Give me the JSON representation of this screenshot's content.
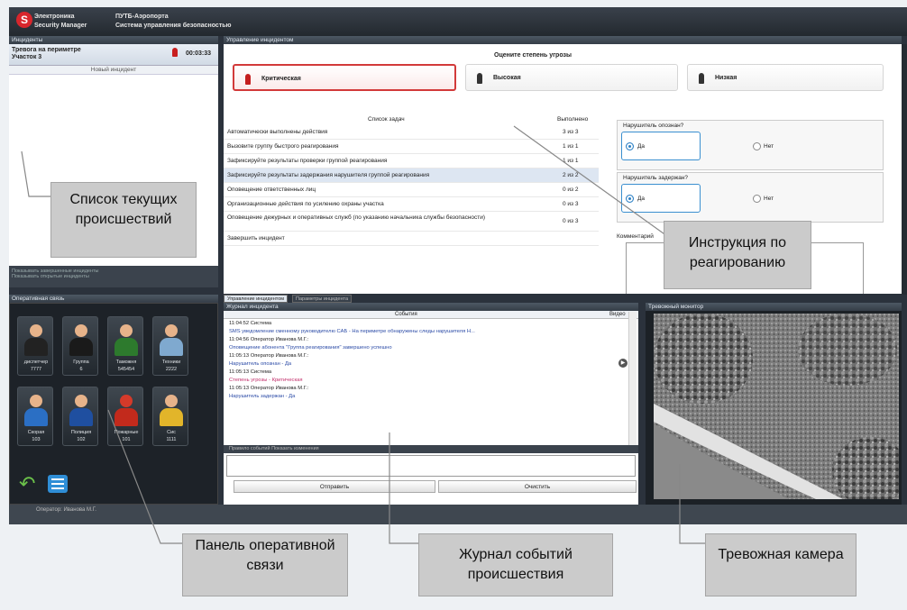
{
  "app": {
    "brand_line1": "Электроника",
    "brand_line2": "Security Manager",
    "title_line1": "ПУТБ-Аэропорта",
    "title_line2": "Система управления безопасностью"
  },
  "panels": {
    "incidents": "Инциденты",
    "management": "Управление инцидентом",
    "comm": "Оперативная связь",
    "log": "Журнал инцидента",
    "alarm_monitor": "Тревожный монитор"
  },
  "incident": {
    "title": "Тревога на периметре",
    "sub": "Участок 3",
    "time": "00:03:33",
    "new_label": "Новый инцидент",
    "footer1": "Показывать завершенные инциденты",
    "footer2": "Показывать открытые инциденты"
  },
  "threat": {
    "question": "Оцените степень угрозы",
    "levels": [
      "Критическая",
      "Высокая",
      "Низкая"
    ]
  },
  "tasks": {
    "header": "Список задач",
    "done_header": "Выполнено",
    "items": [
      {
        "name": "Автоматически выполнены действия",
        "count": "3 из 3"
      },
      {
        "name": "Вызовите группу быстрого реагирования",
        "count": "1 из 1"
      },
      {
        "name": "Зафиксируйте результаты проверки группой реагирования",
        "count": "1 из 1"
      },
      {
        "name": "Зафиксируйте результаты задержания нарушителя группой реагирования",
        "count": "2 из 2"
      },
      {
        "name": "Оповещение ответственных лиц",
        "count": "0 из 2"
      },
      {
        "name": "Организационные действия по усилению охраны участка",
        "count": "0 из 3"
      },
      {
        "name": "Оповещение дежурных и оперативных служб (по указанию начальника службы безопасности)",
        "count": "0 из 3"
      },
      {
        "name": "Завершить инцидент",
        "count": ""
      }
    ]
  },
  "questions": [
    {
      "label": "Нарушитель опознан?",
      "yes": "Да",
      "no": "Нет"
    },
    {
      "label": "Нарушитель задержан?",
      "yes": "Да",
      "no": "Нет"
    }
  ],
  "comment_label": "Комментарий",
  "tabs": [
    "Управление инцидентом",
    "Параметры инцидента"
  ],
  "contacts": [
    {
      "name": "диспетчер",
      "num": "7777",
      "icon": "suit-agent-icon"
    },
    {
      "name": "Группа",
      "num": "6",
      "icon": "guard-icon"
    },
    {
      "name": "Таможня",
      "num": "545454",
      "icon": "customs-officer-icon"
    },
    {
      "name": "Техники",
      "num": "2222",
      "icon": "technician-icon"
    },
    {
      "name": "Скорая",
      "num": "103",
      "icon": "medic-icon"
    },
    {
      "name": "Полиция",
      "num": "102",
      "icon": "police-icon"
    },
    {
      "name": "Пожарные",
      "num": "101",
      "icon": "firefighter-icon"
    },
    {
      "name": "Сис",
      "num": "1111",
      "icon": "sysadmin-icon"
    }
  ],
  "log": {
    "header": "События",
    "col_video": "Видео",
    "entries": [
      {
        "text": "11:04:52    Система",
        "cls": "sys"
      },
      {
        "text": "SMS уведомление сменному руководителю САБ - На периметре обнаружены следы нарушителя Н...",
        "cls": "blue"
      },
      {
        "text": "11:04:56    Оператор Иванова М.Г.:",
        "cls": "sys"
      },
      {
        "text": "Оповещение абонента \"Группа реагирования\" завершено успешно",
        "cls": "blue"
      },
      {
        "text": "11:05:13    Оператор Иванова М.Г.:",
        "cls": "sys"
      },
      {
        "text": "Нарушитель опознан - Да",
        "cls": "blue"
      },
      {
        "text": "11:05:13    Система",
        "cls": "sys"
      },
      {
        "text": "Степень угрозы - Критическая",
        "cls": "pinkc"
      },
      {
        "text": "11:05:13    Оператор Иванова М.Г.:",
        "cls": "sys"
      },
      {
        "text": "Нарушитель задержан - Да",
        "cls": "blue"
      }
    ],
    "msg_bar": "Правило событий    Показать изменения",
    "send": "Отправить",
    "clear": "Очистить"
  },
  "status": {
    "operator": "Оператор: Иванова М.Г."
  },
  "callouts": {
    "list": "Список текущих происшествий",
    "instruction": "Инструкция по реагированию",
    "comm": "Панель оперативной связи",
    "log": "Журнал событий происшествия",
    "camera": "Тревожная камера"
  }
}
